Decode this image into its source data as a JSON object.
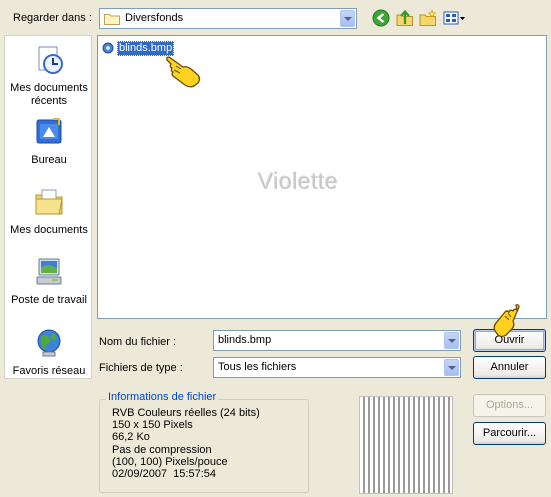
{
  "lookin": {
    "label": "Regarder dans :",
    "value": "Diversfonds"
  },
  "toolbar": {
    "back_icon": "back-icon",
    "up_icon": "up-folder-icon",
    "new_folder_icon": "new-folder-icon",
    "views_icon": "views-menu-icon"
  },
  "places": [
    {
      "label": "Mes documents récents",
      "icon": "recent-documents-icon"
    },
    {
      "label": "Bureau",
      "icon": "desktop-icon"
    },
    {
      "label": "Mes documents",
      "icon": "my-documents-icon"
    },
    {
      "label": "Poste de travail",
      "icon": "my-computer-icon"
    },
    {
      "label": "Favoris réseau",
      "icon": "network-places-icon"
    }
  ],
  "files": [
    {
      "name": "blinds.bmp"
    }
  ],
  "watermark": "Violette",
  "filename": {
    "label": "Nom du fichier :",
    "value": "blinds.bmp"
  },
  "filetype": {
    "label": "Fichiers de type :",
    "value": "Tous les fichiers"
  },
  "buttons": {
    "open": "Ouvrir",
    "cancel": "Annuler",
    "options": "Options...",
    "browse": "Parcourir..."
  },
  "info": {
    "title": "Informations de fichier",
    "lines": [
      "RVB Couleurs réelles (24 bits)",
      "150 x 150 Pixels",
      "66,2 Ko",
      "Pas de compression",
      "(100, 100) Pixels/pouce",
      "02/09/2007  15:57:54"
    ]
  },
  "colors": {
    "selection": "#316AC5",
    "window": "#ECE9D8",
    "info_title": "#0046D5"
  }
}
